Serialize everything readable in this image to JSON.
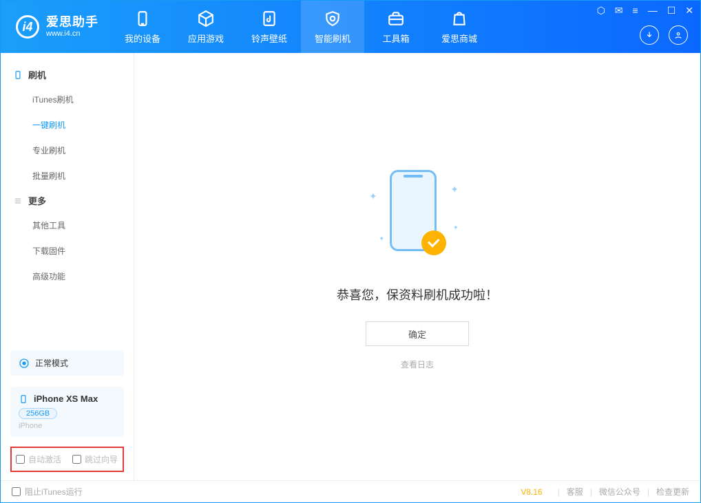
{
  "app": {
    "name": "爱思助手",
    "subtitle": "www.i4.cn"
  },
  "nav": {
    "tabs": [
      {
        "label": "我的设备"
      },
      {
        "label": "应用游戏"
      },
      {
        "label": "铃声壁纸"
      },
      {
        "label": "智能刷机"
      },
      {
        "label": "工具箱"
      },
      {
        "label": "爱思商城"
      }
    ],
    "activeIndex": 3
  },
  "sidebar": {
    "group1": {
      "title": "刷机",
      "items": [
        "iTunes刷机",
        "一键刷机",
        "专业刷机",
        "批量刷机"
      ],
      "activeIndex": 1
    },
    "group2": {
      "title": "更多",
      "items": [
        "其他工具",
        "下载固件",
        "高级功能"
      ]
    }
  },
  "mode": {
    "label": "正常模式"
  },
  "device": {
    "name": "iPhone XS Max",
    "capacity": "256GB",
    "type": "iPhone"
  },
  "options": {
    "autoActivate": "自动激活",
    "skipGuide": "跳过向导"
  },
  "main": {
    "message": "恭喜您，保资料刷机成功啦！",
    "ok": "确定",
    "logLink": "查看日志"
  },
  "footer": {
    "blockItunes": "阻止iTunes运行",
    "version": "V8.16",
    "links": [
      "客服",
      "微信公众号",
      "检查更新"
    ]
  }
}
